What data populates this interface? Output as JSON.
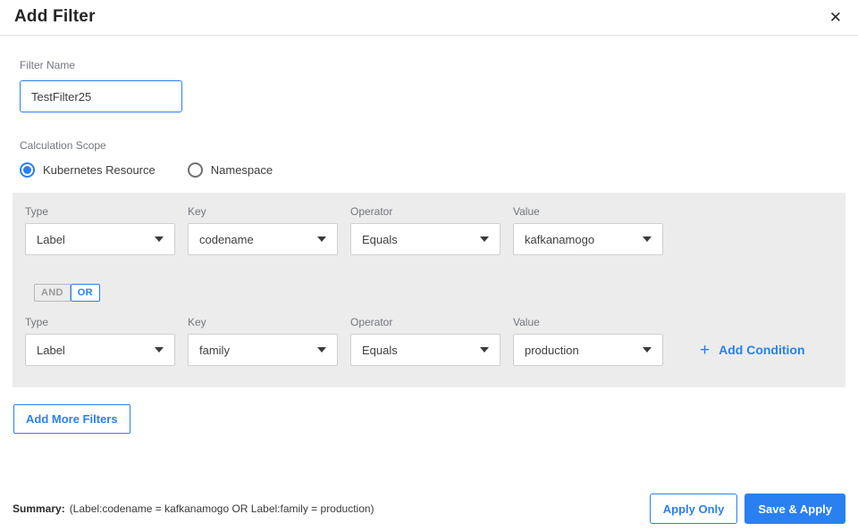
{
  "header": {
    "title": "Add Filter",
    "close_icon": "✕"
  },
  "filter_name": {
    "label": "Filter Name",
    "value": "TestFilter25"
  },
  "calculation_scope": {
    "label": "Calculation Scope",
    "options": [
      {
        "label": "Kubernetes Resource",
        "selected": true
      },
      {
        "label": "Namespace",
        "selected": false
      }
    ]
  },
  "conditions": {
    "rows": [
      {
        "fields": [
          {
            "label": "Type",
            "value": "Label"
          },
          {
            "label": "Key",
            "value": "codename"
          },
          {
            "label": "Operator",
            "value": "Equals"
          },
          {
            "label": "Value",
            "value": "kafkanamogo"
          }
        ]
      },
      {
        "fields": [
          {
            "label": "Type",
            "value": "Label"
          },
          {
            "label": "Key",
            "value": "family"
          },
          {
            "label": "Operator",
            "value": "Equals"
          },
          {
            "label": "Value",
            "value": "production"
          }
        ]
      }
    ],
    "logic_toggle": {
      "and_label": "AND",
      "or_label": "OR",
      "selected": "OR"
    },
    "add_condition": {
      "plus_icon": "+",
      "label": "Add Condition"
    }
  },
  "add_more_filters_label": "Add More Filters",
  "footer": {
    "summary_label": "Summary:",
    "summary_text": "(Label:codename = kafkanamogo OR Label:family = production)",
    "apply_only_label": "Apply Only",
    "save_apply_label": "Save & Apply"
  },
  "colors": {
    "accent_blue": "#2a80f0",
    "panel_gray": "#ececec"
  }
}
